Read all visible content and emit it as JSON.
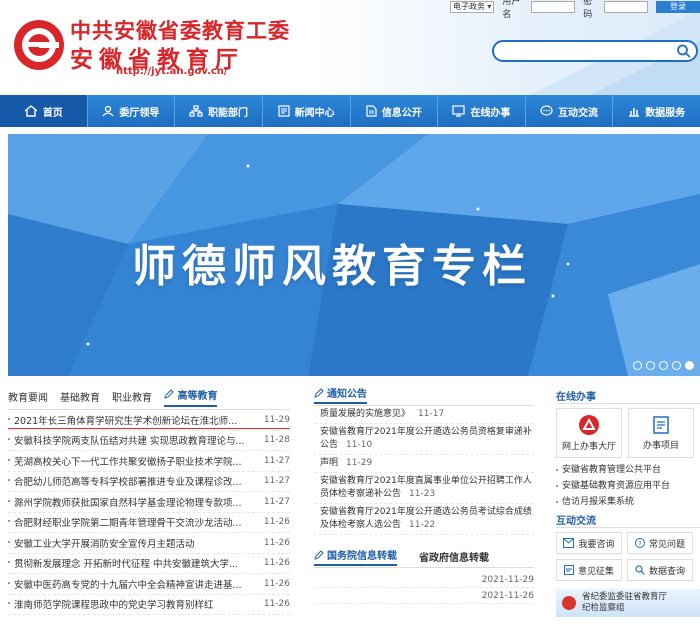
{
  "header": {
    "org_line1": "中共安徽省委教育工委",
    "org_line2": "安徽省教育厅",
    "url": "http://jyt.ah.gov.cn/",
    "select_value": "电子政务",
    "username_label": "用户名",
    "password_label": "密码",
    "login_label": "登录",
    "search_placeholder": ""
  },
  "nav": {
    "items": [
      {
        "label": "首页",
        "icon": "home-icon"
      },
      {
        "label": "委厅领导",
        "icon": "user-icon"
      },
      {
        "label": "职能部门",
        "icon": "org-icon"
      },
      {
        "label": "新闻中心",
        "icon": "news-icon"
      },
      {
        "label": "信息公开",
        "icon": "doc-icon"
      },
      {
        "label": "在线办事",
        "icon": "service-icon"
      },
      {
        "label": "互动交流",
        "icon": "chat-icon"
      },
      {
        "label": "数据服务",
        "icon": "chart-icon"
      }
    ]
  },
  "banner": {
    "title": "师德师风教育专栏",
    "slide_count": 5,
    "active_slide": 5
  },
  "edu": {
    "tabs": [
      "教育要闻",
      "基础教育",
      "职业教育",
      "高等教育"
    ],
    "active_tab": "高等教育",
    "news": [
      {
        "title": "2021年长三角体育学研究生学术创新论坛在淮北师...",
        "date": "11-29"
      },
      {
        "title": "安徽科技学院两支队伍结对共建 实现思政教育理论与...",
        "date": "11-28"
      },
      {
        "title": "芜湖高校关心下一代工作共聚安徽扬子职业技术学院...",
        "date": "11-27"
      },
      {
        "title": "合肥幼儿师范高等专科学校部署推进专业及课程诊改...",
        "date": "11-27"
      },
      {
        "title": "滁州学院教师获批国家自然科学基金理论物理专款项...",
        "date": "11-27"
      },
      {
        "title": "合肥财经职业学院第二期青年管理骨干交流沙龙活动...",
        "date": "11-26"
      },
      {
        "title": "安徽工业大学开展消防安全宣传月主题活动",
        "date": "11-26"
      },
      {
        "title": "贯彻新发展理念 开拓新时代征程 中共安徽建筑大学...",
        "date": "11-26"
      },
      {
        "title": "安徽中医药高专党的十九届六中全会精神宣讲走进基...",
        "date": "11-26"
      },
      {
        "title": "淮南师范学院课程思政中的党史学习教育别样红",
        "date": "11-26"
      }
    ]
  },
  "notice": {
    "title": "通知公告",
    "items": [
      {
        "title": "质量发展的实施意见》",
        "date": "11-17"
      },
      {
        "title": "安徽省教育厅2021年度公开遴选公务员资格复审递补公告",
        "date": "11-10"
      },
      {
        "title": "声明",
        "date": "11-29"
      },
      {
        "title": "安徽省教育厅2021年度直属事业单位公开招聘工作人员体检考察递补公告",
        "date": "11-23"
      },
      {
        "title": "安徽省教育厅2021年度公开遴选公务员考试综合成绩及体检考察人选公告",
        "date": "11-22"
      }
    ]
  },
  "gov": {
    "tab1": "国务院信息转载",
    "tab2": "省政府信息转载",
    "rows": [
      {
        "title": "",
        "date": "2021-11-29"
      },
      {
        "title": "",
        "date": "2021-11-26"
      }
    ]
  },
  "side": {
    "online_title": "在线办事",
    "svc1": "网上办事大厅",
    "svc2": "办事项目",
    "links": [
      "安徽省教育管理公共平台",
      "安徽基础教育资源应用平台",
      "信访月报采集系统"
    ],
    "interact_title": "互动交流",
    "buttons": [
      "我要咨询",
      "常见问题",
      "意见征集",
      "数据查询"
    ],
    "supervise_line1": "省纪委监委驻省教育厅",
    "supervise_line2": "纪检监察组"
  },
  "colors": {
    "brand_blue": "#1f6ec2",
    "brand_red": "#d8262a"
  }
}
